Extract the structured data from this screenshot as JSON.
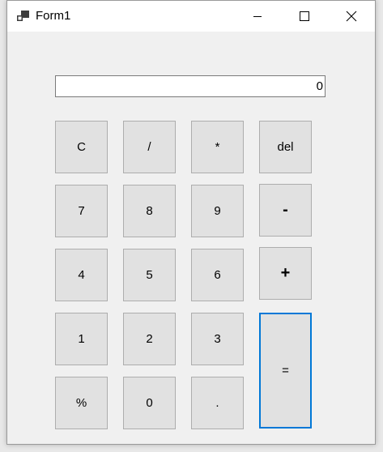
{
  "window": {
    "title": "Form1",
    "icon": "form-app-icon",
    "controls": {
      "minimize": "minimize-icon",
      "maximize": "maximize-icon",
      "close": "close-icon"
    }
  },
  "display": {
    "value": "0"
  },
  "keys": {
    "clear": "C",
    "divide": "/",
    "multiply": "*",
    "delete": "del",
    "seven": "7",
    "eight": "8",
    "nine": "9",
    "minus": "-",
    "four": "4",
    "five": "5",
    "six": "6",
    "plus": "+",
    "one": "1",
    "two": "2",
    "three": "3",
    "equals": "=",
    "percent": "%",
    "zero": "0",
    "decimal": "."
  },
  "colors": {
    "focus_border": "#0078d7",
    "button_face": "#e1e1e1",
    "form_background": "#f0f0f0"
  }
}
